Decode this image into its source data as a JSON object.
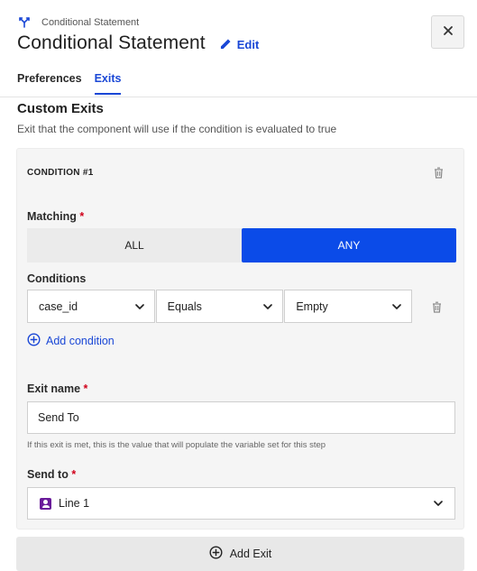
{
  "header": {
    "breadcrumb": "Conditional Statement",
    "breadcrumb_icon": "branch-icon",
    "title": "Conditional Statement",
    "edit_label": "Edit",
    "close_icon": "close-icon",
    "accent_color": "#1a47d6"
  },
  "tabs": [
    {
      "label": "Preferences",
      "active": false
    },
    {
      "label": "Exits",
      "active": true
    }
  ],
  "section": {
    "title": "Custom Exits",
    "description": "Exit that the component will use if the condition is evaluated to true"
  },
  "condition": {
    "heading": "CONDITION #1",
    "matching_label": "Matching",
    "required_mark": "*",
    "matching_options": [
      "ALL",
      "ANY"
    ],
    "matching_selected": "ANY",
    "conditions_label": "Conditions",
    "row": {
      "field": "case_id",
      "operator": "Equals",
      "value": "Empty"
    },
    "add_condition_label": "Add condition",
    "exit_name_label": "Exit name",
    "exit_name_value": "Send To",
    "exit_name_help": "If this exit is met, this is the value that will populate the variable set for this step",
    "send_to_label": "Send to",
    "send_to_value": "Line 1",
    "send_to_icon": "contact-icon",
    "send_to_icon_color": "#6a1b9a"
  },
  "footer": {
    "add_exit_label": "Add Exit"
  }
}
